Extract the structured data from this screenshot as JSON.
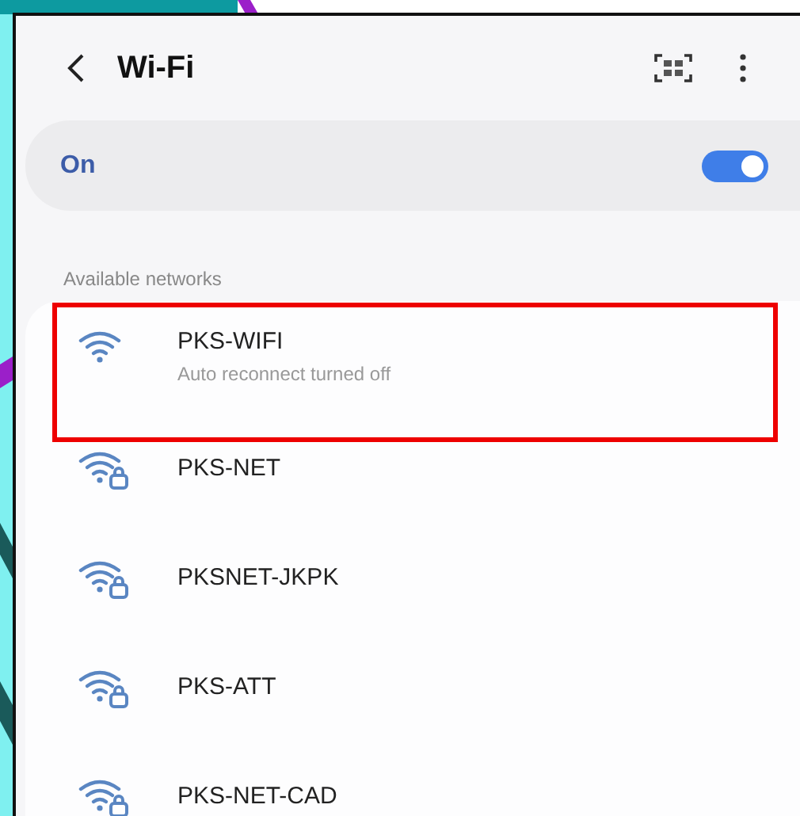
{
  "header": {
    "title": "Wi-Fi"
  },
  "master_switch": {
    "label": "On",
    "on": true
  },
  "section_label": "Available networks",
  "networks": [
    {
      "name": "PKS-WIFI",
      "status": "Auto reconnect turned off",
      "secured": false,
      "highlighted": true
    },
    {
      "name": "PKS-NET",
      "secured": true,
      "highlighted": false
    },
    {
      "name": "PKSNET-JKPK",
      "secured": true,
      "highlighted": false
    },
    {
      "name": "PKS-ATT",
      "secured": true,
      "highlighted": false
    },
    {
      "name": "PKS-NET-CAD",
      "secured": true,
      "highlighted": false
    }
  ]
}
